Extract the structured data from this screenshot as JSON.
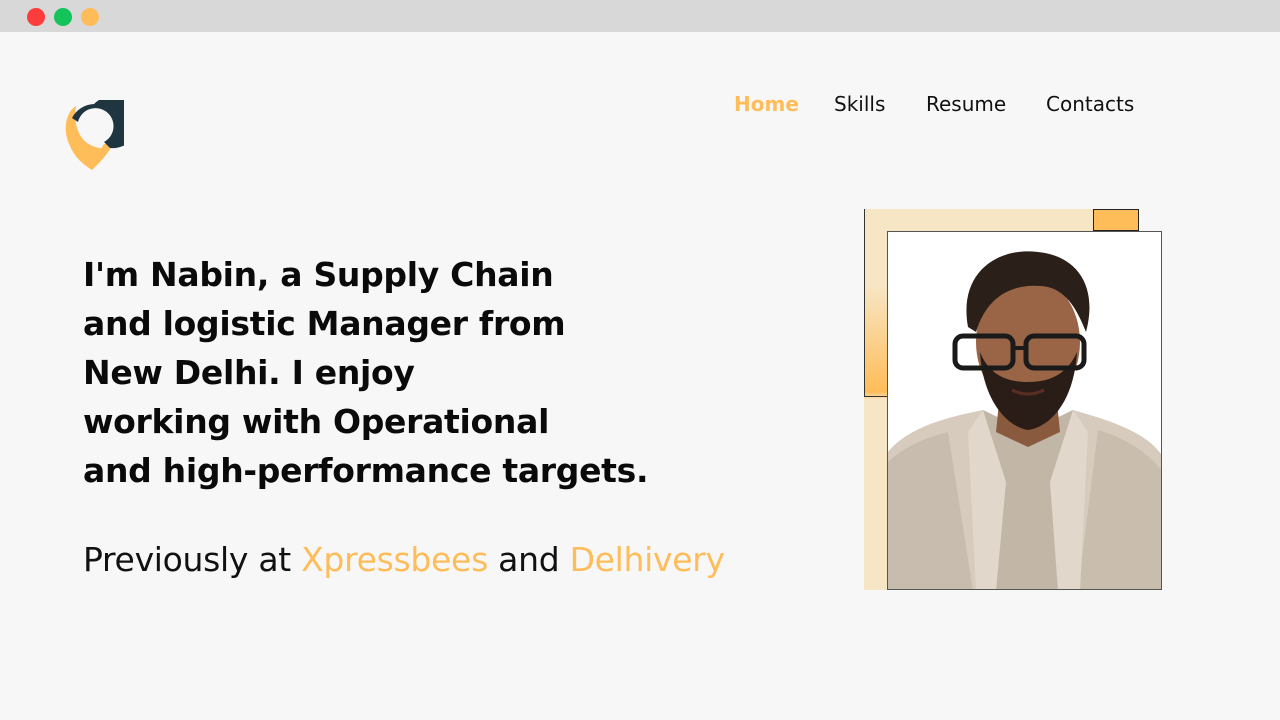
{
  "window": {
    "controls": [
      "close",
      "maximize",
      "minimize"
    ],
    "colors": {
      "close": "#fd3d3b",
      "maximize": "#14c45a",
      "minimize": "#ffbd59"
    }
  },
  "logo": {
    "icon": "location-pin-chat-icon"
  },
  "nav": {
    "items": [
      {
        "label": "Home",
        "active": true
      },
      {
        "label": "Skills",
        "active": false
      },
      {
        "label": "Resume",
        "active": false
      },
      {
        "label": "Contacts",
        "active": false
      }
    ]
  },
  "hero": {
    "headline_lines": [
      "I'm Nabin, a Supply Chain",
      "and logistic Manager from",
      "New Delhi. I enjoy",
      "working with Operational",
      "and high-performance targets."
    ],
    "previously_prefix": "Previously at",
    "company_1": "Xpressbees",
    "conjunction": "and",
    "company_2": "Delhivery"
  },
  "portrait": {
    "subject": "profile-photo"
  },
  "colors": {
    "accent": "#ffbd59",
    "dark": "#1f3640",
    "background": "#f7f7f7",
    "frame_light": "#f7e6c5"
  }
}
